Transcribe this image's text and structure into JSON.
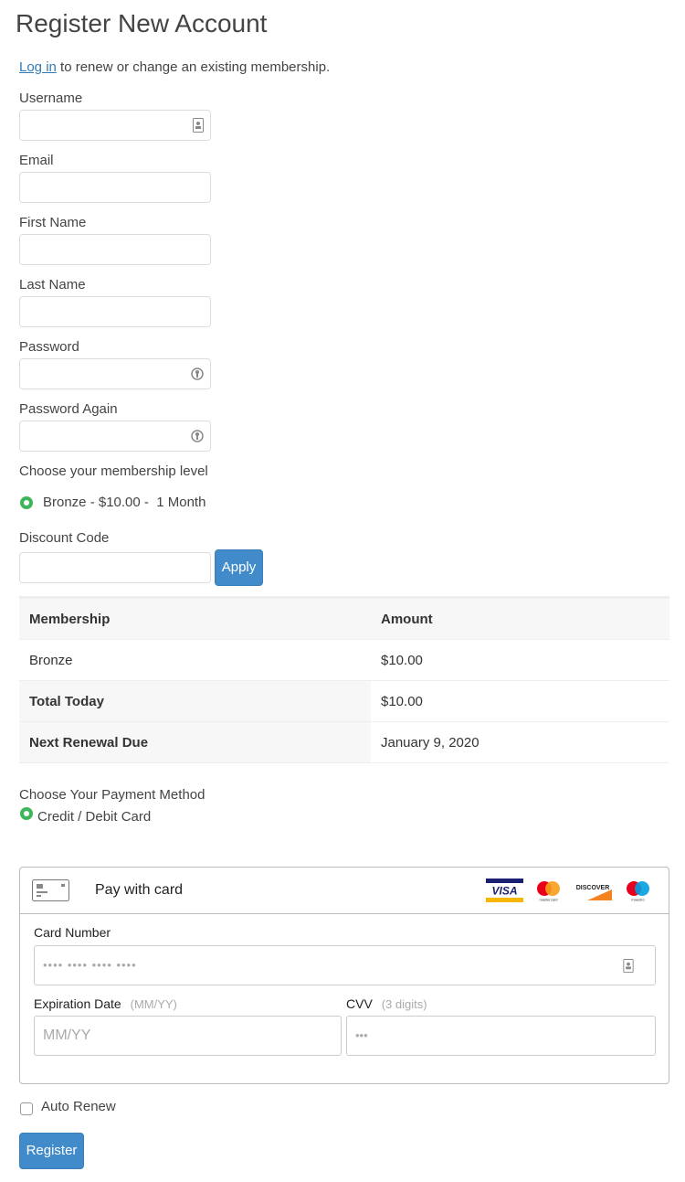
{
  "page": {
    "title": "Register New Account"
  },
  "intro": {
    "link_text": "Log in",
    "text": " to renew or change an existing membership."
  },
  "fields": {
    "username": {
      "label": "Username",
      "value": ""
    },
    "email": {
      "label": "Email",
      "value": ""
    },
    "first_name": {
      "label": "First Name",
      "value": ""
    },
    "last_name": {
      "label": "Last Name",
      "value": ""
    },
    "password": {
      "label": "Password",
      "value": ""
    },
    "password_again": {
      "label": "Password Again",
      "value": ""
    }
  },
  "membership": {
    "heading": "Choose your membership level",
    "option": "Bronze - $10.00 -  1 Month"
  },
  "discount": {
    "label": "Discount Code",
    "value": "",
    "apply_label": "Apply"
  },
  "summary": {
    "headers": [
      "Membership",
      "Amount"
    ],
    "rows": [
      [
        "Bronze",
        "$10.00"
      ],
      [
        "Total Today",
        "$10.00"
      ],
      [
        "Next Renewal Due",
        "January 9, 2020"
      ]
    ]
  },
  "payment": {
    "heading": "Choose Your Payment Method",
    "option": "Credit / Debit Card"
  },
  "card": {
    "title": "Pay with card",
    "brands": [
      "VISA",
      "mastercard",
      "DISCOVER",
      "maestro"
    ],
    "number_label": "Card Number",
    "number_placeholder": "•••• •••• •••• ••••",
    "exp_label": "Expiration Date",
    "exp_hint": "(MM/YY)",
    "exp_placeholder": "MM/YY",
    "cvv_label": "CVV",
    "cvv_hint": "(3 digits)",
    "cvv_placeholder": "•••"
  },
  "auto_renew": {
    "label": "Auto Renew",
    "checked": false
  },
  "register": {
    "label": "Register"
  },
  "colors": {
    "accent": "#428bca",
    "radio": "#3cb55b",
    "link": "#337ab7"
  },
  "icons": [
    "contact-card-icon",
    "password-key-icon",
    "credit-card-icon"
  ]
}
